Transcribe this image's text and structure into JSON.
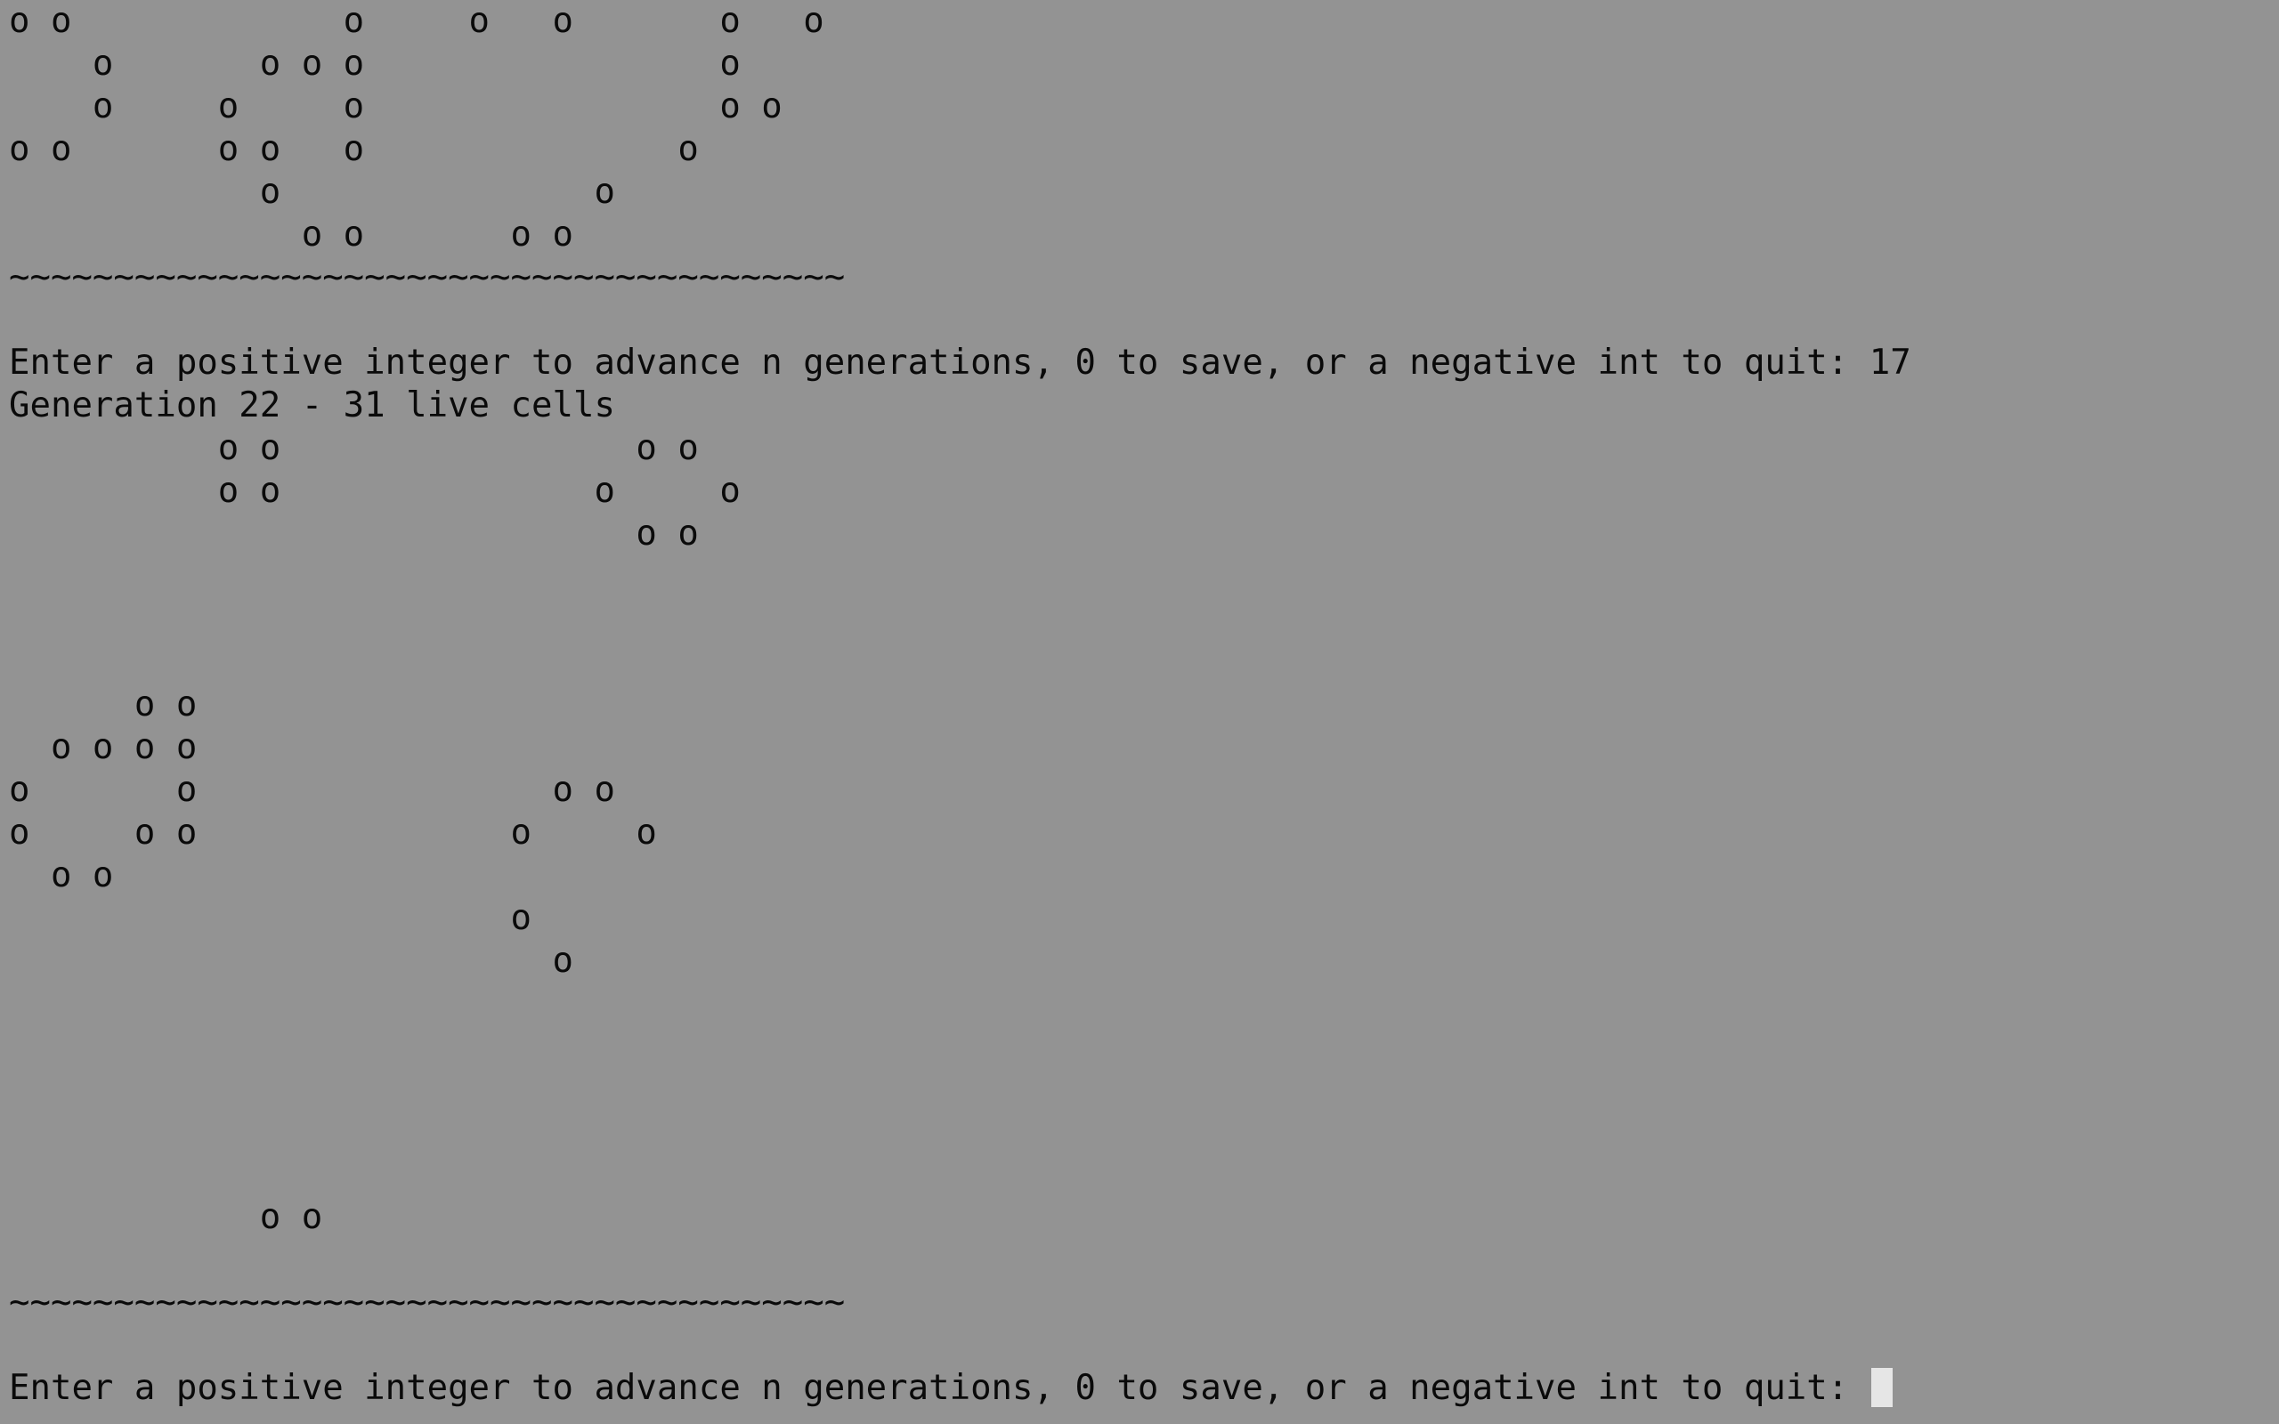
{
  "colors": {
    "background": "#939393",
    "text": "#0a0a0a",
    "cursor": "#e6e6e6"
  },
  "terminal": {
    "lines": [
      "o o             o     o   o       o   o",
      "    o       o o o                 o",
      "    o     o     o                 o o",
      "o o       o o   o               o",
      "            o               o",
      "              o o       o o",
      "~~~~~~~~~~~~~~~~~~~~~~~~~~~~~~~~~~~~~~~~",
      "",
      "Enter a positive integer to advance n generations, 0 to save, or a negative int to quit: 17",
      "Generation 22 - 31 live cells",
      "          o o                 o o",
      "          o o               o     o",
      "                              o o",
      "",
      "",
      "",
      "      o o",
      "  o o o o",
      "o       o                 o o",
      "o     o o               o     o",
      "  o o",
      "                        o",
      "                          o",
      "",
      "",
      "",
      "",
      "",
      "            o o",
      "",
      "~~~~~~~~~~~~~~~~~~~~~~~~~~~~~~~~~~~~~~~~",
      "",
      "Enter a positive integer to advance n generations, 0 to save, or a negative int to quit: "
    ],
    "cursor_line": 32
  }
}
